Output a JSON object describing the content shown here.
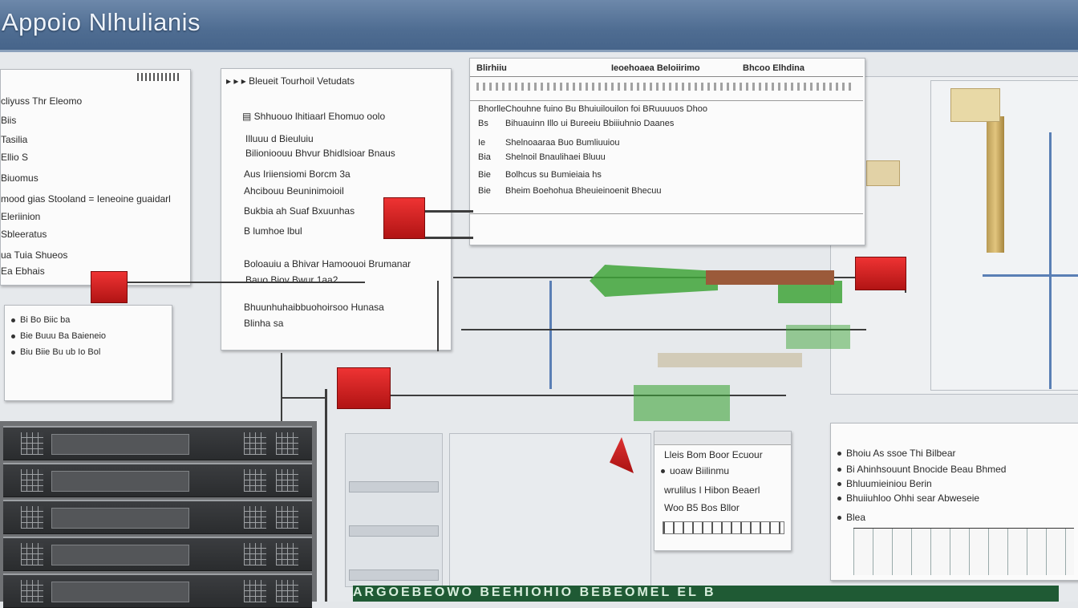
{
  "app": {
    "title": "Appoio Nlhulianis"
  },
  "left_panel": {
    "items": [
      "cliyuss Thr Eleomo",
      "Biis",
      "Tasilia",
      "Ellio S",
      "Biuomus",
      "mood gias Stooland = Ieneoine guaidarl",
      "Eleriinion",
      "Sbleeratus",
      "ua Tuia Shueos",
      "Ea Ebhais"
    ]
  },
  "center_panel": {
    "header": "Bleueit Tourhoil Vetudats",
    "items": [
      "Shhuouo lhitiaarl Ehomuo oolo",
      "Illuuu d Bieuluiu",
      "Bilionioouu Bhvur Bhidlsioar Bnaus",
      "Aus Iriiensiomi Borcm 3a",
      "Ahcibouu Beuninimoioil",
      "Bukbia ah Suaf Bxuunhas",
      "B lumhoe lbul",
      "Boloauiu a Bhivar Hamoouoi Brumanar",
      "Bauo Biov Bwur 1aa2",
      "Bhuunhuhaibbuohoirsoo Hunasa",
      "Blinha sa"
    ]
  },
  "top_table": {
    "headers": [
      "Blirhiiu",
      "Ieoehoaea Beloiirimo",
      "Bhcoo Elhdina"
    ],
    "rows": [
      {
        "label": "Bhorlle",
        "text": "Chouhne fuino Bu Bhuiuilouilon foi BRuuuuos Dhoo"
      },
      {
        "label": "Bs",
        "text": "Bihuauinn Illo ui Bureeiu Bbiiiuhnio Daanes"
      },
      {
        "label": "Ie",
        "text": "Shelnoaaraa Buo Bumliuuiou"
      },
      {
        "label": "Bia",
        "text": "Shelnoil Bnaulihaei Bluuu"
      },
      {
        "label": "Bie",
        "text": "Bolhcus su Bumieiaia hs"
      },
      {
        "label": "Bie",
        "text": "Bheim Boehohua Bheuieinoenit Bhecuu"
      }
    ]
  },
  "small_popup_left": {
    "items": [
      "Bi Bo Biic ba",
      "Bie Buuu Ba Baieneio",
      "Biu Biie Bu ub Io Bol"
    ]
  },
  "popup_center": {
    "items": [
      "Lleis Bom Boor Ecuour",
      "uoaw Biilinmu",
      "wrulilus I Hibon Beaerl",
      "Woo B5 Bos Bllor"
    ]
  },
  "popup_right": {
    "items": [
      "Bhoiu As ssoe Thi Bilbear",
      "Bi Ahinhsouunt Bnocide Beau Bhmed",
      "Bhluumieiniou Berin",
      "Bhuiiuhloo Ohhi sear Abweseie"
    ],
    "footer": "Blea"
  },
  "banner": {
    "text": "ARGOEBEOWO BEEHIOHIO BEBEOMEL EL B"
  },
  "colors": {
    "titlebar": "#4f6d92",
    "alarm": "#c41a1a",
    "flow": "#3fa53a",
    "accent": "#5a7fb5"
  },
  "icons": [
    "square-bullet-icon",
    "document-icon",
    "chevron-right-icon",
    "pipe-valve-icon"
  ]
}
